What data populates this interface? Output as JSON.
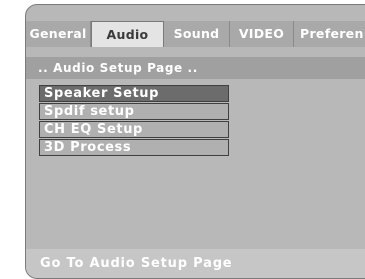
{
  "tabs": [
    {
      "label": "General",
      "active": false
    },
    {
      "label": "Audio",
      "active": true
    },
    {
      "label": "Sound",
      "active": false
    },
    {
      "label": "VIDEO",
      "active": false
    },
    {
      "label": "Preferen",
      "active": false
    }
  ],
  "header": {
    "title": ".. Audio Setup Page .."
  },
  "menu": {
    "items": [
      {
        "label": "Speaker Setup",
        "selected": true
      },
      {
        "label": "Spdif setup",
        "selected": false
      },
      {
        "label": "CH EQ Setup",
        "selected": false
      },
      {
        "label": "3D Process",
        "selected": false
      }
    ]
  },
  "footer": {
    "status": "Go To Audio Setup Page"
  },
  "colors": {
    "panel": "#b8b8b8",
    "active_tab": "#e4e4e4",
    "selected_item": "#6c6c6c",
    "text": "#ffffff"
  }
}
